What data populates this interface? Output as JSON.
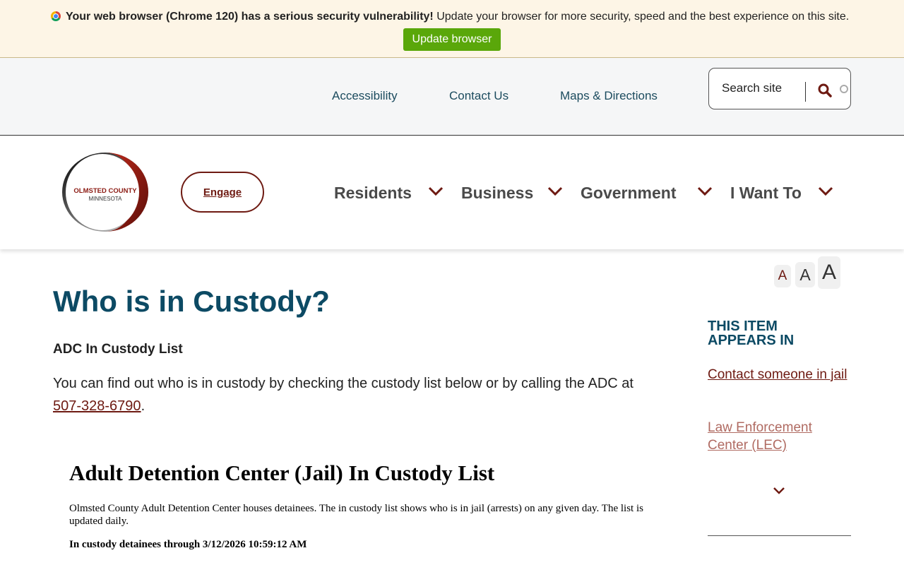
{
  "banner": {
    "bold_text": "Your web browser (Chrome 120) has a serious security vulnerability!",
    "text": " Update your browser for more security, speed and the best experience on this site.",
    "button_label": "Update browser"
  },
  "utility_nav": {
    "links": [
      "Accessibility",
      "Contact Us",
      "Maps & Directions"
    ],
    "search_placeholder": "Search site"
  },
  "logo": {
    "line1": "OLMSTED COUNTY",
    "line2": "MINNESOTA"
  },
  "main_nav": {
    "engage_label": "Engage",
    "items": [
      "Residents",
      "Business",
      "Government",
      "I Want To"
    ]
  },
  "font_sizer": {
    "labels": [
      "A",
      "A",
      "A"
    ]
  },
  "content": {
    "title": "Who is in Custody?",
    "subheading": "ADC In Custody List",
    "intro_text": "You can find out who is in custody by checking the custody list below or by calling the ADC at ",
    "phone": "507-328-6790",
    "intro_end": ".",
    "embed_title": "Adult Detention Center (Jail) In Custody List",
    "embed_desc": "Olmsted County Adult Detention Center houses detainees. The in custody list shows who is in jail (arrests) on any given day.  The list is updated daily.",
    "embed_date": "In custody detainees through 3/12/2026 10:59:12 AM"
  },
  "sidebar": {
    "heading": "THIS ITEM APPEARS IN",
    "links": [
      "Contact someone in jail",
      "Law Enforcement Center (LEC)"
    ]
  },
  "colors": {
    "brand_maroon": "#6e1a12",
    "heading_teal": "#0c4a64",
    "update_green": "#5aa70a",
    "banner_bg": "#fdf5e6"
  }
}
